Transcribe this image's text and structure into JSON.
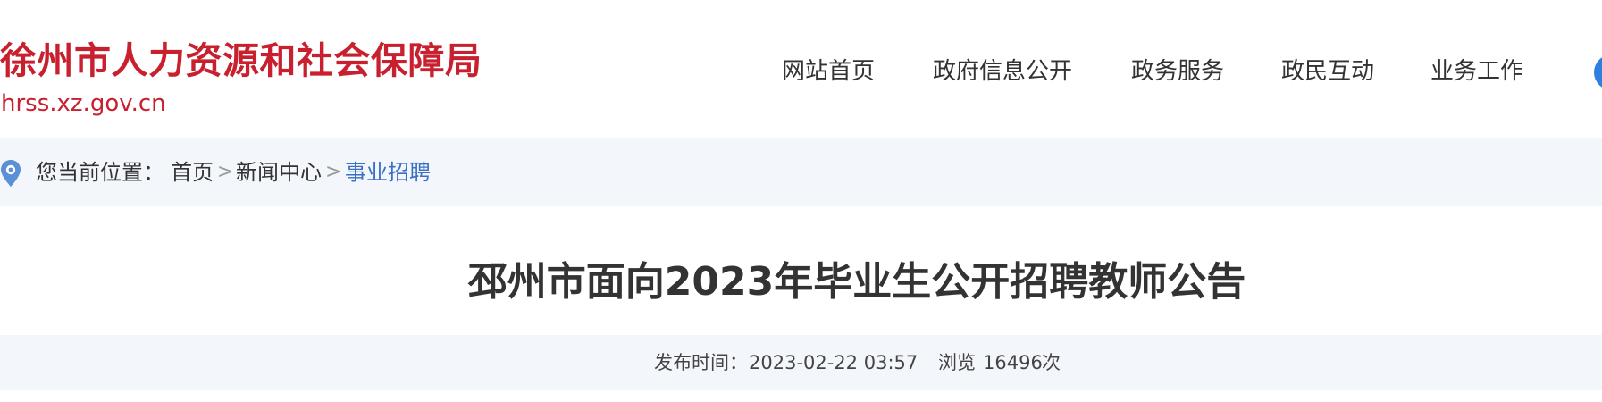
{
  "header": {
    "site_name": "徐州市人力资源和社会保障局",
    "site_domain": "hrss.xz.gov.cn"
  },
  "nav": {
    "items": [
      {
        "label": "网站首页"
      },
      {
        "label": "政府信息公开"
      },
      {
        "label": "政务服务"
      },
      {
        "label": "政民互动"
      },
      {
        "label": "业务工作"
      }
    ]
  },
  "breadcrumb": {
    "prefix": "您当前位置：",
    "items": [
      {
        "label": "首页"
      },
      {
        "label": "新闻中心"
      }
    ],
    "separator": ">",
    "current": "事业招聘"
  },
  "article": {
    "title": "邳州市面向2023年毕业生公开招聘教师公告",
    "publish_label": "发布时间：",
    "publish_time": "2023-02-22 03:57",
    "views_label": "浏览",
    "views_count": "16496",
    "views_unit": "次"
  },
  "colors": {
    "brand_red": "#c8202f",
    "link_blue": "#3a6fc4",
    "bar_bg": "#f3f7fb",
    "text": "#333333"
  },
  "icons": {
    "location": "location-pin-icon",
    "nav_extra": "circle-icon"
  }
}
